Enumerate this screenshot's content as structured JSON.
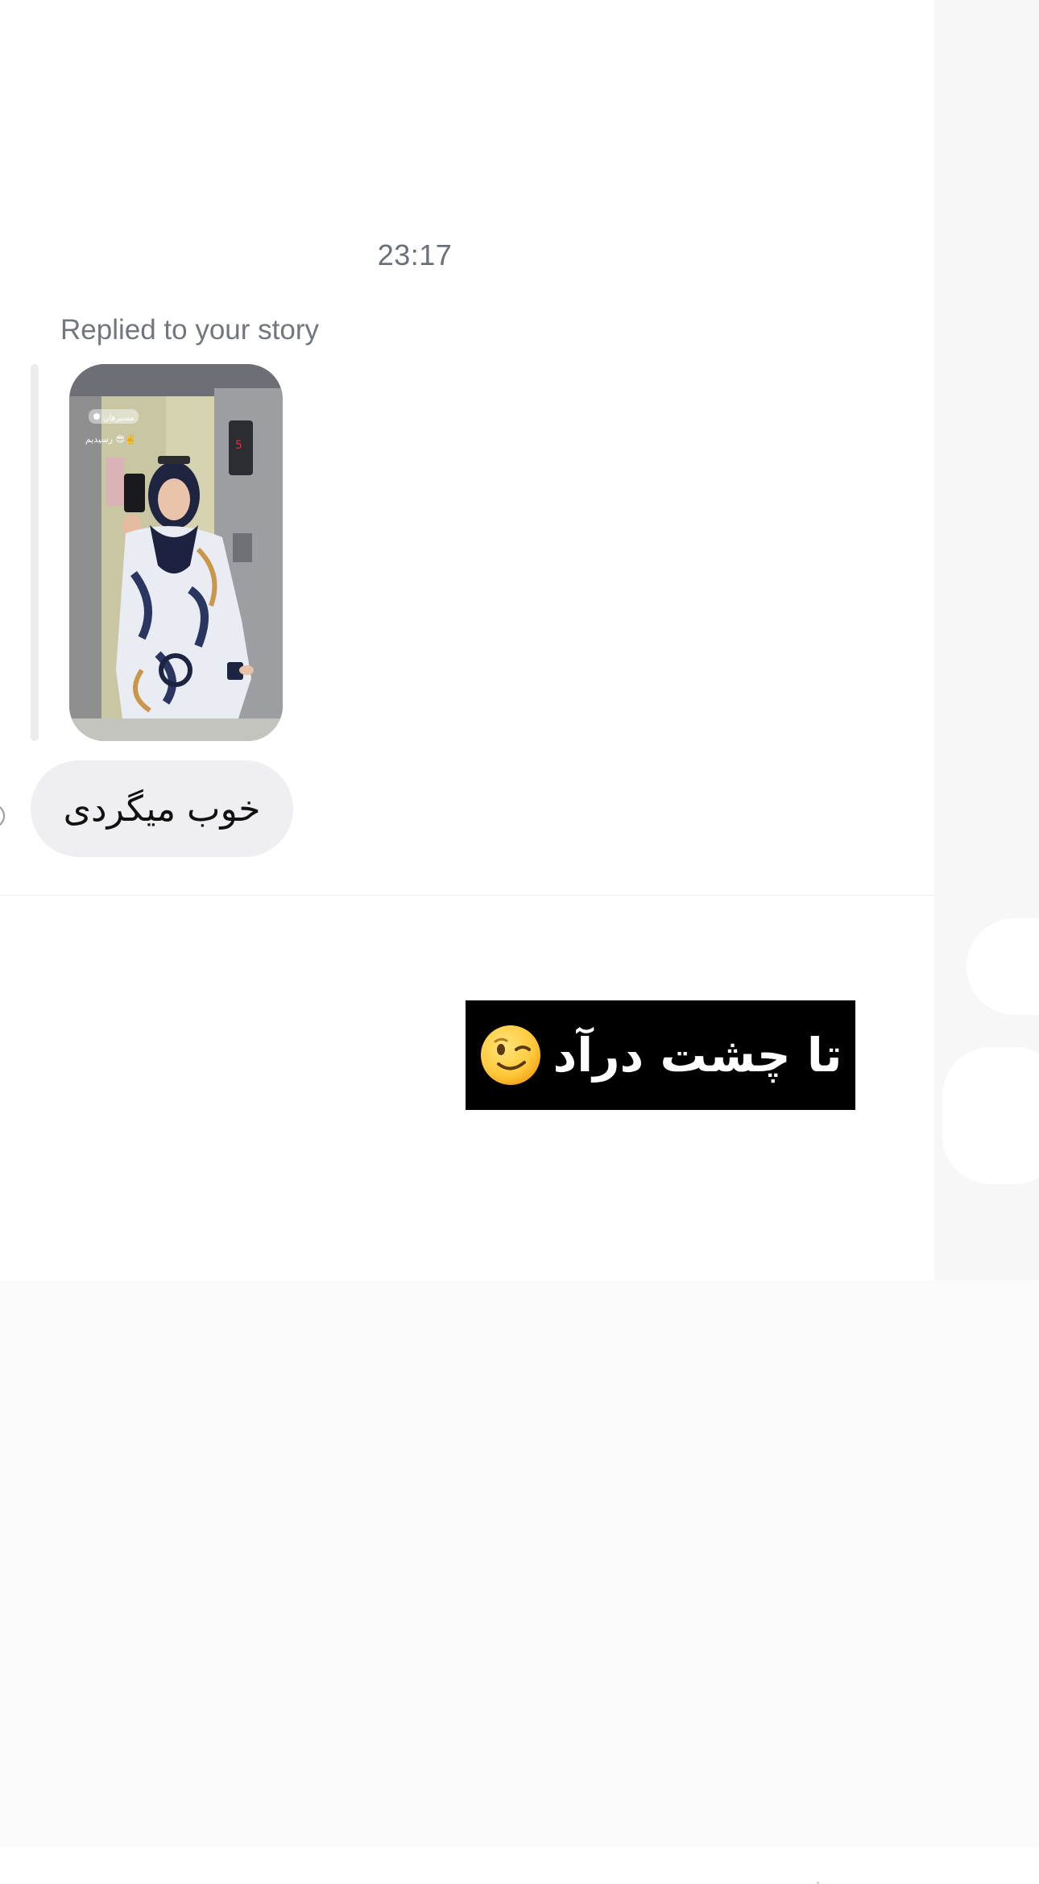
{
  "conversation": {
    "timestamp": "23:17",
    "story_reply_label": "Replied to your story",
    "story_thumbnail": {
      "location_sticker": "مسیرهان",
      "caption_sticker": "رسیدیم 😎✌️"
    },
    "message": {
      "text": "خوب میگردی"
    }
  },
  "overlay": {
    "caption": "تا چشت درآد",
    "emoji": "winking-face-emoji"
  },
  "colors": {
    "bubble": "#efeff2",
    "timestamp_text": "#6b6f78",
    "caption_background": "#000000",
    "caption_text": "#ffffff"
  }
}
